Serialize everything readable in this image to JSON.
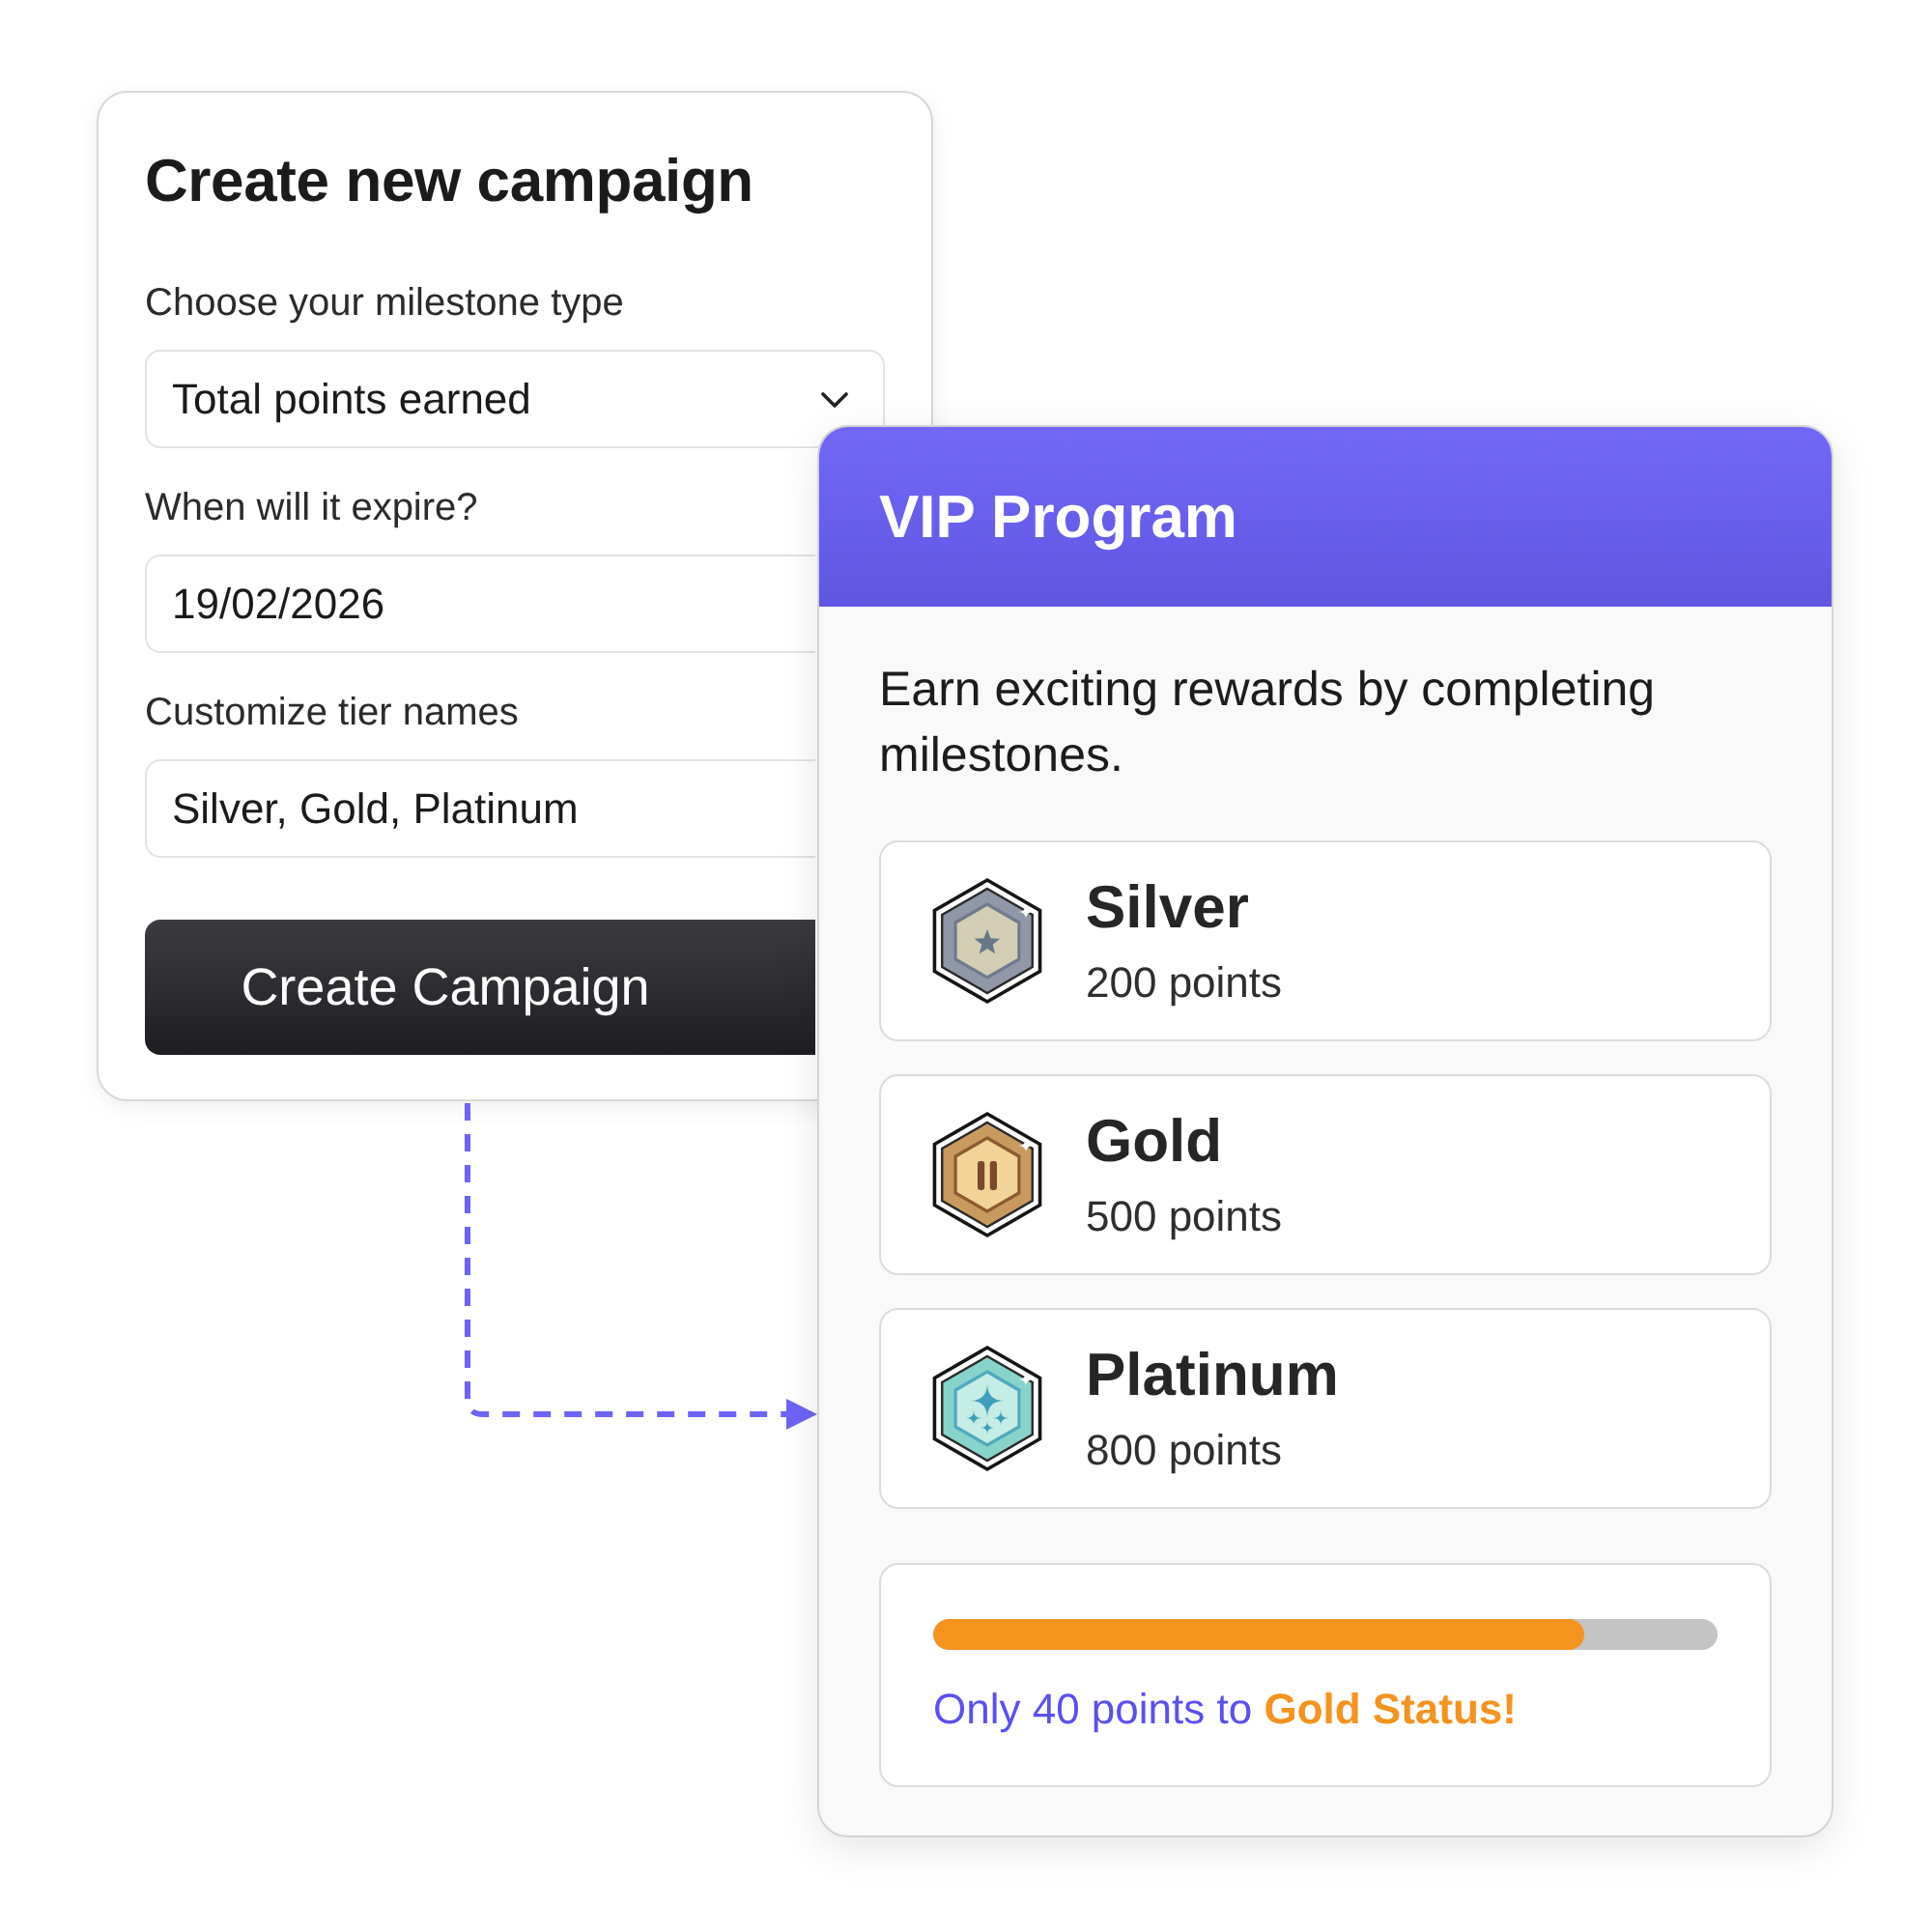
{
  "campaign_form": {
    "title": "Create new campaign",
    "fields": [
      {
        "kind": "select",
        "label": "Choose your milestone type",
        "value": "Total points earned"
      },
      {
        "kind": "text",
        "label": "When will it expire?",
        "value": "19/02/2026"
      },
      {
        "kind": "text",
        "label": "Customize tier names",
        "value": "Silver, Gold, Platinum"
      }
    ],
    "submit_button": "Create Campaign"
  },
  "vip_program": {
    "title": "VIP Program",
    "description": "Earn exciting rewards by completing milestones.",
    "tiers": [
      {
        "kind": "silver",
        "name": "Silver",
        "points": "200 points"
      },
      {
        "kind": "gold",
        "name": "Gold",
        "points": "500 points"
      },
      {
        "kind": "platinum",
        "name": "Platinum",
        "points": "800 points"
      }
    ],
    "progress": {
      "level": 0.83,
      "message": "Only 40 points to **Gold Status!**"
    }
  }
}
